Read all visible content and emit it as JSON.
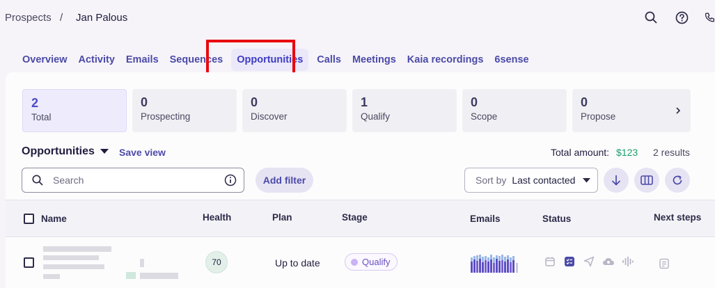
{
  "breadcrumb": {
    "parent": "Prospects",
    "separator": "/",
    "current": "Jan Palous"
  },
  "top_icons": [
    "search-icon",
    "help-icon",
    "phone-icon"
  ],
  "tabs": [
    {
      "label": "Overview",
      "active": false
    },
    {
      "label": "Activity",
      "active": false
    },
    {
      "label": "Emails",
      "active": false
    },
    {
      "label": "Sequences",
      "active": false
    },
    {
      "label": "Opportunities",
      "active": true
    },
    {
      "label": "Calls",
      "active": false
    },
    {
      "label": "Meetings",
      "active": false
    },
    {
      "label": "Kaia recordings",
      "active": false
    },
    {
      "label": "6sense",
      "active": false
    }
  ],
  "stats": [
    {
      "num": "2",
      "label": "Total",
      "active": true
    },
    {
      "num": "0",
      "label": "Prospecting"
    },
    {
      "num": "0",
      "label": "Discover"
    },
    {
      "num": "1",
      "label": "Qualify"
    },
    {
      "num": "0",
      "label": "Scope"
    },
    {
      "num": "0",
      "label": "Propose"
    }
  ],
  "toolbar": {
    "view_title": "Opportunities",
    "save_view": "Save view",
    "total_label": "Total amount:",
    "total_value": "$123",
    "results": "2 results",
    "search_placeholder": "Search",
    "add_filter": "Add filter",
    "sort_prefix": "Sort by",
    "sort_value": "Last contacted"
  },
  "table": {
    "headers": {
      "name": "Name",
      "health": "Health",
      "plan": "Plan",
      "stage": "Stage",
      "emails": "Emails",
      "status": "Status",
      "next_steps": "Next steps"
    },
    "rows": [
      {
        "health": "70",
        "plan": "Up to date",
        "stage": "Qualify"
      }
    ]
  },
  "colors": {
    "accent": "#4b4aa8",
    "highlight": "#e8090f",
    "amount": "#18a06a"
  }
}
